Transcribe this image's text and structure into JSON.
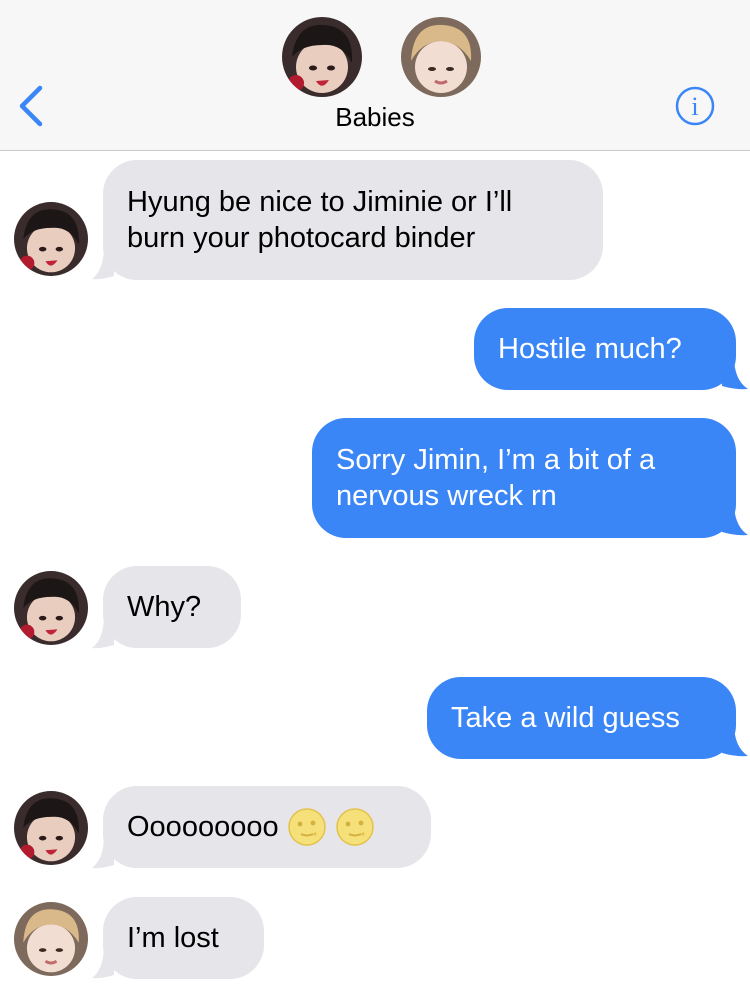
{
  "header": {
    "title": "Babies",
    "avatars": [
      {
        "name": "member-1",
        "icon": "avatar-dark-hair"
      },
      {
        "name": "member-2",
        "icon": "avatar-light-hair"
      }
    ],
    "back_icon": "chevron-left-icon",
    "info_icon": "info-icon"
  },
  "colors": {
    "incoming_bubble": "#e5e5ea",
    "outgoing_bubble": "#3b86f7",
    "accent": "#3b86f7"
  },
  "messages": [
    {
      "direction": "incoming",
      "sender": "avatar-dark-hair",
      "line1": "Hyung be nice to Jiminie or I’ll",
      "line2": "burn your photocard binder"
    },
    {
      "direction": "outgoing",
      "text": "Hostile much?"
    },
    {
      "direction": "outgoing",
      "line1": "Sorry Jimin, I’m a bit of a",
      "line2": "nervous wreck rn"
    },
    {
      "direction": "incoming",
      "sender": "avatar-dark-hair",
      "text": "Why?"
    },
    {
      "direction": "outgoing",
      "text": "Take a wild guess"
    },
    {
      "direction": "incoming",
      "sender": "avatar-dark-hair",
      "text": "Ooooooooo",
      "emojis": [
        "moon-face-emoji",
        "moon-face-emoji"
      ]
    },
    {
      "direction": "incoming",
      "sender": "avatar-light-hair",
      "text": "I’m lost"
    }
  ]
}
